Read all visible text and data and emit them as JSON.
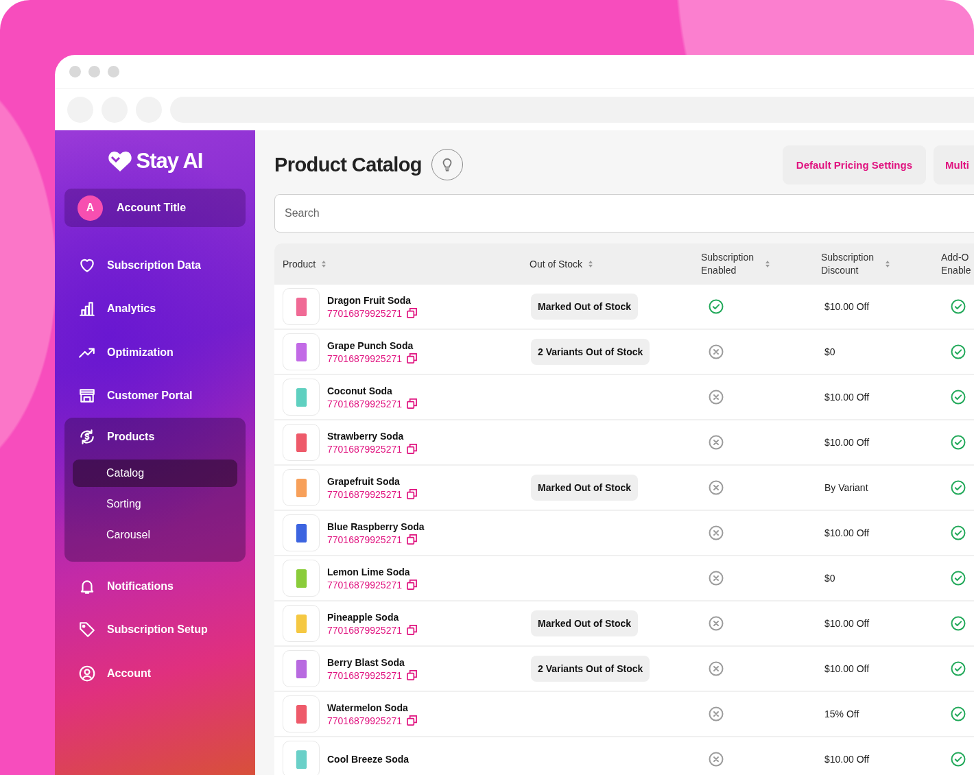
{
  "app": {
    "logo": "Stay AI",
    "account": {
      "initial": "A",
      "title": "Account Title"
    }
  },
  "sidebar": {
    "items": [
      {
        "label": "Subscription Data",
        "selected": false
      },
      {
        "label": "Analytics",
        "selected": false
      },
      {
        "label": "Optimization",
        "selected": false
      },
      {
        "label": "Customer Portal",
        "selected": false
      },
      {
        "label": "Products",
        "selected": false,
        "expanded": true,
        "children": [
          {
            "label": "Catalog",
            "selected": true
          },
          {
            "label": "Sorting",
            "selected": false
          },
          {
            "label": "Carousel",
            "selected": false
          }
        ]
      },
      {
        "label": "Notifications",
        "selected": false
      },
      {
        "label": "Subscription Setup",
        "selected": false
      },
      {
        "label": "Account",
        "selected": false
      }
    ]
  },
  "page": {
    "title": "Product Catalog",
    "buttons": [
      "Default Pricing Settings",
      "Multi"
    ],
    "search": {
      "placeholder": "Search"
    }
  },
  "table": {
    "columns": [
      {
        "lines": [
          "Product"
        ]
      },
      {
        "lines": [
          "Out of Stock"
        ]
      },
      {
        "lines": [
          "Subscription",
          "Enabled"
        ]
      },
      {
        "lines": [
          "Subscription",
          "Discount"
        ]
      },
      {
        "lines": [
          "Add-O",
          "Enable"
        ]
      }
    ],
    "rows": [
      {
        "name": "Dragon Fruit Soda",
        "sku": "77016879925271",
        "color": "#f06a95",
        "out_of_stock": "Marked Out of Stock",
        "subscription_enabled": true,
        "discount": "$10.00 Off",
        "addon_enabled": true
      },
      {
        "name": "Grape Punch Soda",
        "sku": "77016879925271",
        "color": "#c26ae6",
        "out_of_stock": "2 Variants Out of Stock",
        "subscription_enabled": false,
        "discount": "$0",
        "addon_enabled": true
      },
      {
        "name": "Coconut Soda",
        "sku": "77016879925271",
        "color": "#5fd0c0",
        "subscription_enabled": false,
        "discount": "$10.00 Off",
        "addon_enabled": true
      },
      {
        "name": "Strawberry Soda",
        "sku": "77016879925271",
        "color": "#ee5a6a",
        "subscription_enabled": false,
        "discount": "$10.00 Off",
        "addon_enabled": true
      },
      {
        "name": "Grapefruit Soda",
        "sku": "77016879925271",
        "color": "#f7a05a",
        "out_of_stock": "Marked Out of Stock",
        "subscription_enabled": false,
        "discount": "By Variant",
        "addon_enabled": true
      },
      {
        "name": "Blue Raspberry Soda",
        "sku": "77016879925271",
        "color": "#3c64e0",
        "subscription_enabled": false,
        "discount": "$10.00 Off",
        "addon_enabled": true
      },
      {
        "name": "Lemon Lime Soda",
        "sku": "77016879925271",
        "color": "#8acc3a",
        "subscription_enabled": false,
        "discount": "$0",
        "addon_enabled": true
      },
      {
        "name": "Pineapple Soda",
        "sku": "77016879925271",
        "color": "#f5c842",
        "out_of_stock": "Marked Out of Stock",
        "subscription_enabled": false,
        "discount": "$10.00 Off",
        "addon_enabled": true
      },
      {
        "name": "Berry Blast Soda",
        "sku": "77016879925271",
        "color": "#b86ae0",
        "out_of_stock": "2 Variants Out of Stock",
        "subscription_enabled": false,
        "discount": "$10.00 Off",
        "addon_enabled": true
      },
      {
        "name": "Watermelon Soda",
        "sku": "77016879925271",
        "color": "#ee5a6a",
        "subscription_enabled": false,
        "discount": "15% Off",
        "addon_enabled": true
      },
      {
        "name": "Cool Breeze Soda",
        "color": "#6ad0c8",
        "subscription_enabled": false,
        "discount": "$10.00 Off",
        "addon_enabled": true
      }
    ]
  }
}
